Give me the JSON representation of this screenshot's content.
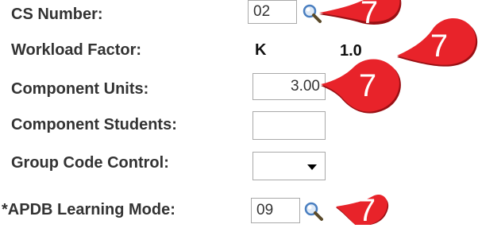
{
  "fields": {
    "cs_number": {
      "label": "CS Number:",
      "value": "02"
    },
    "workload_factor": {
      "label": "Workload Factor:",
      "code": "K",
      "value": "1.0"
    },
    "component_units": {
      "label": "Component Units:",
      "value": "3.00"
    },
    "component_students": {
      "label": "Component Students:",
      "value": ""
    },
    "group_code_control": {
      "label": "Group Code Control:",
      "value": ""
    },
    "apdb_learning_mode": {
      "label": "*APDB Learning Mode:",
      "value": "09"
    }
  },
  "callouts": {
    "cs_number": "7",
    "workload_factor": "7",
    "component_units": "7",
    "apdb_learning_mode": "7"
  },
  "colors": {
    "callout_red": "#e8232a",
    "callout_shadow": "#9a1014",
    "label_text": "#333333",
    "border": "#a9a9a9",
    "icon_lens": "#4a7fc0"
  },
  "icons": {
    "lookup": "magnifier-icon",
    "dropdown": "chevron-down-icon"
  }
}
